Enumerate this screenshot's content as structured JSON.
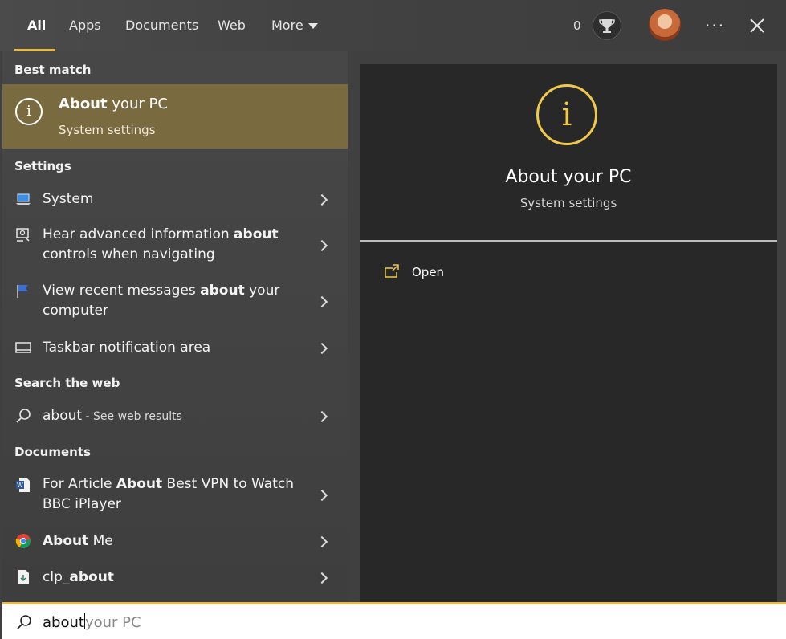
{
  "tabs": [
    {
      "label": "All",
      "active": true
    },
    {
      "label": "Apps"
    },
    {
      "label": "Documents"
    },
    {
      "label": "Web"
    },
    {
      "label": "More"
    }
  ],
  "header": {
    "points": "0",
    "trophy_icon": "trophy-icon",
    "more_options": "···"
  },
  "sections": {
    "best_match": "Best match",
    "settings": "Settings",
    "search_web": "Search the web",
    "documents": "Documents"
  },
  "best_match": {
    "title_bold": "About",
    "title_rest": " your PC",
    "subtitle": "System settings"
  },
  "settings_items": [
    {
      "before": "System",
      "bold": "",
      "after": ""
    },
    {
      "before": "Hear advanced information ",
      "bold": "about",
      "after": "",
      "line2": "controls when navigating"
    },
    {
      "before": "View recent messages ",
      "bold": "about",
      "after": " your",
      "line2": "computer"
    },
    {
      "before": "Taskbar notification area",
      "bold": "",
      "after": ""
    }
  ],
  "web_item": {
    "query": "about",
    "suffix": " - See web results"
  },
  "document_items": [
    {
      "before": "For Article ",
      "bold": "About",
      "after": " Best VPN to Watch",
      "line2": "BBC iPlayer"
    },
    {
      "before": "",
      "bold": "About",
      "after": " Me"
    },
    {
      "before": "clp_",
      "bold": "about",
      "after": ""
    }
  ],
  "detail": {
    "title": "About your PC",
    "subtitle": "System settings",
    "open_label": "Open"
  },
  "search": {
    "typed": "about",
    "suggestion": "your PC"
  },
  "colors": {
    "accent": "#e6b94a",
    "best_match_bg": "#7a6a40",
    "info_yellow": "#f0c84a"
  }
}
